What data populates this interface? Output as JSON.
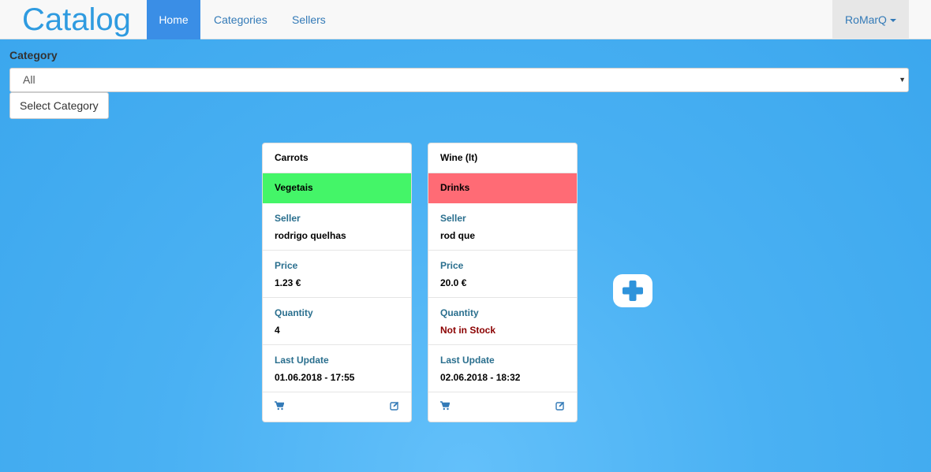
{
  "brand": "Catalog",
  "nav": {
    "home": "Home",
    "categories": "Categories",
    "sellers": "Sellers",
    "user": "RoMarQ"
  },
  "filter": {
    "label": "Category",
    "selected": "All",
    "button": "Select Category"
  },
  "colors": {
    "brand": "#2f9be0",
    "vegetais": "#44f568",
    "drinks": "#ff6b75"
  },
  "products": [
    {
      "name": "Carrots",
      "category": "Vegetais",
      "seller_label": "Seller",
      "seller": "rodrigo quelhas",
      "price_label": "Price",
      "price": "1.23 €",
      "quantity_label": "Quantity",
      "quantity": "4",
      "update_label": "Last Update",
      "update": "01.06.2018 - 17:55"
    },
    {
      "name": "Wine (lt)",
      "category": "Drinks",
      "seller_label": "Seller",
      "seller": "rod que",
      "price_label": "Price",
      "price": "20.0 €",
      "quantity_label": "Quantity",
      "quantity": "Not in Stock",
      "update_label": "Last Update",
      "update": "02.06.2018 - 18:32"
    }
  ],
  "icons": {
    "cart": "cart-icon",
    "edit": "edit-icon",
    "add": "plus-icon"
  }
}
